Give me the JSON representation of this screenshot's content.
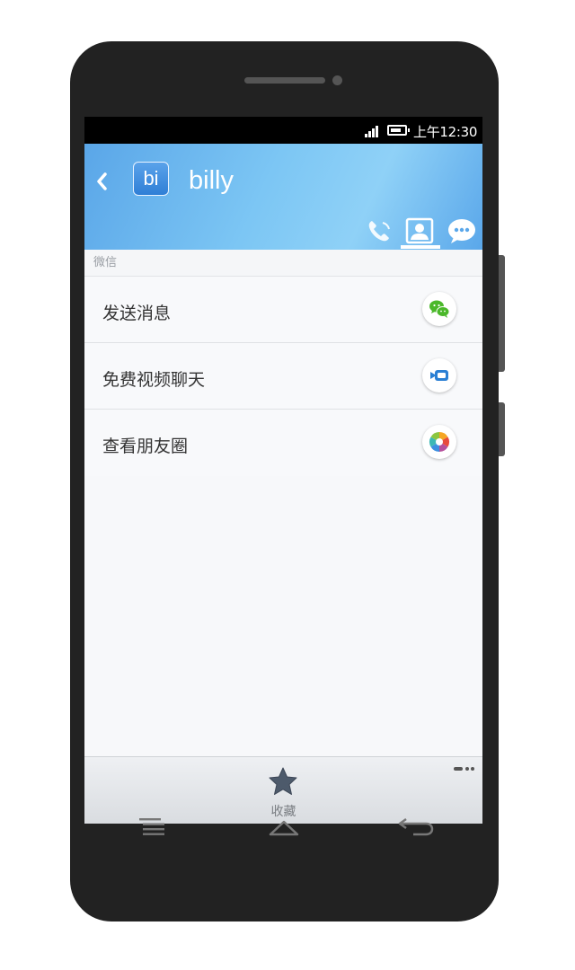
{
  "status_bar": {
    "time": "上午12:30",
    "icons": [
      "signal-icon",
      "battery-icon"
    ]
  },
  "header": {
    "avatar_text": "bi",
    "contact_name": "billy",
    "tabs": [
      "phone-icon",
      "contact-card-icon",
      "chat-bubble-icon"
    ],
    "active_tab": "contact-card-icon"
  },
  "section": {
    "label": "微信"
  },
  "actions": [
    {
      "label": "发送消息",
      "icon": "wechat-icon"
    },
    {
      "label": "免费视频聊天",
      "icon": "video-call-icon"
    },
    {
      "label": "查看朋友圈",
      "icon": "moments-icon"
    }
  ],
  "bottom_bar": {
    "favorite_label": "收藏",
    "icons": [
      "star-icon",
      "more-icon"
    ]
  },
  "colors": {
    "header_blue": "#6db8f0",
    "wechat_green": "#4bb82a",
    "video_blue": "#2a7fd4"
  }
}
